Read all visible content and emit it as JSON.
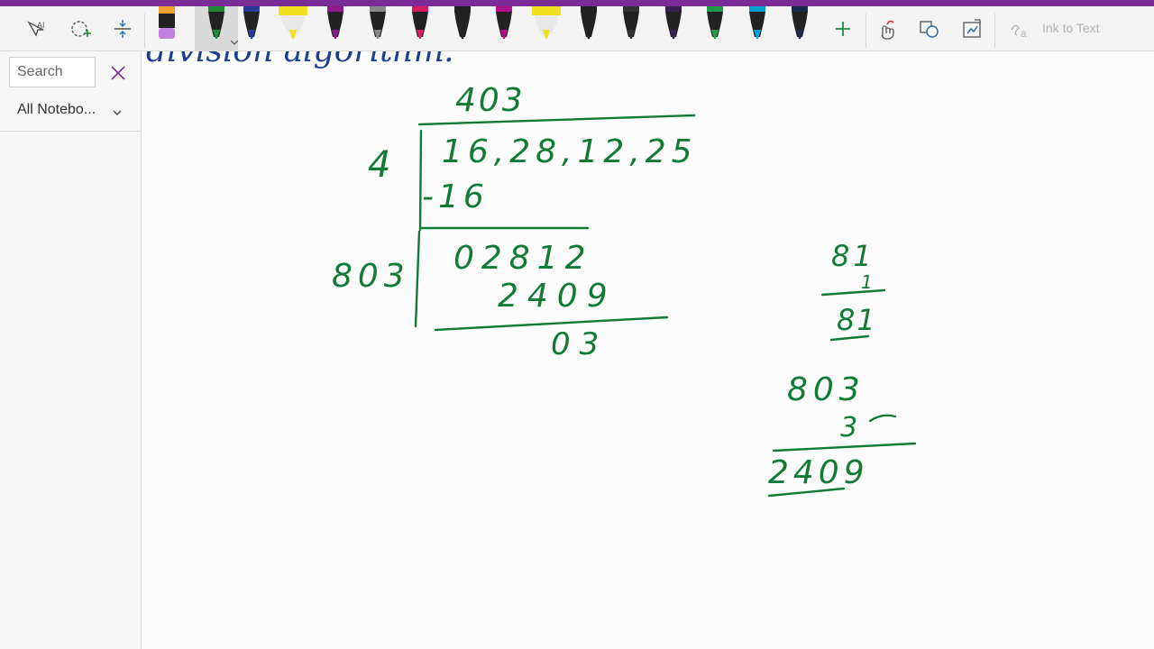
{
  "toolbar": {
    "tools": [
      "lasso-select-icon",
      "add-space-icon",
      "type-select-icon"
    ],
    "pens": [
      {
        "name": "orange-pen",
        "color": "#f0a030"
      },
      {
        "name": "green-pen-selected",
        "color": "#1a8a3a"
      },
      {
        "name": "blue-pen",
        "color": "#2b3a9c"
      },
      {
        "name": "yellow-highlighter",
        "color": "#f0e020"
      },
      {
        "name": "purple-pen",
        "color": "#8b1a8b"
      },
      {
        "name": "gray-pen",
        "color": "#888888"
      },
      {
        "name": "pink-pen",
        "color": "#d81b60"
      },
      {
        "name": "black-pen",
        "color": "#222222"
      },
      {
        "name": "magenta-pen",
        "color": "#b0108a"
      },
      {
        "name": "yellow-highlighter-2",
        "color": "#f0e020"
      },
      {
        "name": "black-pen-2",
        "color": "#222222"
      },
      {
        "name": "black-pen-3",
        "color": "#333333"
      },
      {
        "name": "dark-purple-pen",
        "color": "#3a2050"
      },
      {
        "name": "green-pen-2",
        "color": "#1f9a4a"
      },
      {
        "name": "cyan-pen",
        "color": "#00a0d0"
      },
      {
        "name": "navy-pen",
        "color": "#1a2a50"
      }
    ],
    "add_pen": "+",
    "ink_to_text_label": "Ink to Text"
  },
  "sidebar": {
    "search_placeholder": "Search",
    "notebook_filter": "All Notebo..."
  },
  "ink": {
    "heading_fragment": "division algorithm:",
    "quotient": "403",
    "divisor": "4",
    "dividend": "16,28,12,25",
    "first_subtract": "-16",
    "second_divisor": "803",
    "second_dividend": "02812",
    "second_subtract": "2409",
    "remainder": "03",
    "side_calc_1": {
      "top": "81",
      "mult": "1",
      "result": "81"
    },
    "side_calc_2": {
      "top": "803",
      "mult": "3",
      "result": "2409"
    }
  },
  "colors": {
    "accent": "#7a2b95",
    "ink_green": "#117a35",
    "ink_blue": "#1d3f8f"
  }
}
